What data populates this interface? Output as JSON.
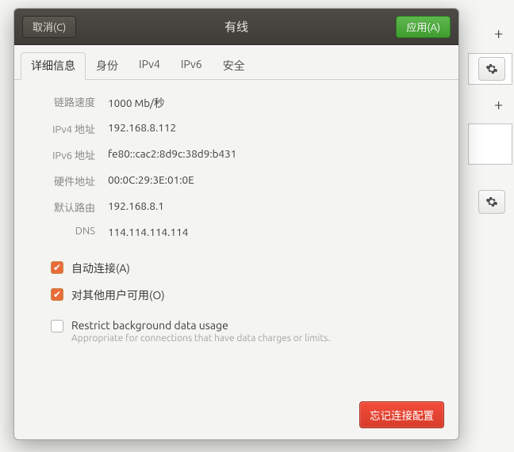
{
  "dialog": {
    "title": "有线",
    "cancel_label": "取消(C)",
    "apply_label": "应用(A)"
  },
  "tabs": {
    "details": "详细信息",
    "identity": "身份",
    "ipv4": "IPv4",
    "ipv6": "IPv6",
    "security": "安全"
  },
  "details": {
    "rows": [
      {
        "label": "链路速度",
        "value": "1000 Mb/秒"
      },
      {
        "label": "IPv4 地址",
        "value": "192.168.8.112"
      },
      {
        "label": "IPv6 地址",
        "value": "fe80::cac2:8d9c:38d9:b431"
      },
      {
        "label": "硬件地址",
        "value": "00:0C:29:3E:01:0E"
      },
      {
        "label": "默认路由",
        "value": "192.168.8.1"
      },
      {
        "label": "DNS",
        "value": "114.114.114.114"
      }
    ]
  },
  "options": {
    "auto_connect": {
      "label": "自动连接(A)",
      "checked": true
    },
    "available_all": {
      "label": "对其他用户可用(O)",
      "checked": true
    },
    "restrict_bg": {
      "label": "Restrict background data usage",
      "sub": "Appropriate for connections that have data charges or limits.",
      "checked": false
    }
  },
  "footer": {
    "forget_label": "忘记连接配置"
  },
  "bg_icons": {
    "plus": "+"
  }
}
